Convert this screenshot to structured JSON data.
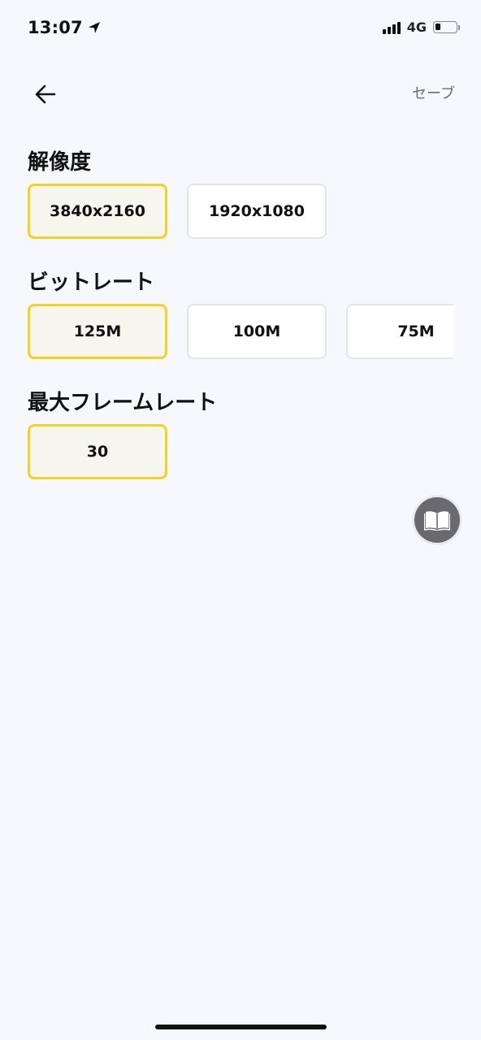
{
  "status_bar": {
    "time": "13:07",
    "network": "4G",
    "icons": [
      "location-arrow-icon",
      "signal-icon",
      "battery-icon"
    ]
  },
  "nav": {
    "back_icon": "arrow-left-icon",
    "save_label": "セーブ"
  },
  "sections": [
    {
      "title": "解像度",
      "options": [
        {
          "label": "3840x2160",
          "selected": true
        },
        {
          "label": "1920x1080",
          "selected": false
        }
      ]
    },
    {
      "title": "ビットレート",
      "options": [
        {
          "label": "125M",
          "selected": true
        },
        {
          "label": "100M",
          "selected": false
        },
        {
          "label": "75M",
          "selected": false
        }
      ]
    },
    {
      "title": "最大フレームレート",
      "options": [
        {
          "label": "30",
          "selected": true
        }
      ]
    }
  ],
  "fab": {
    "icon": "book-icon"
  },
  "colors": {
    "background": "#f7f8fc",
    "selected_border": "#f5d21f",
    "selected_fill": "#f6f5ee",
    "option_border": "#e3e4ea",
    "save_text": "#6b6b70"
  }
}
